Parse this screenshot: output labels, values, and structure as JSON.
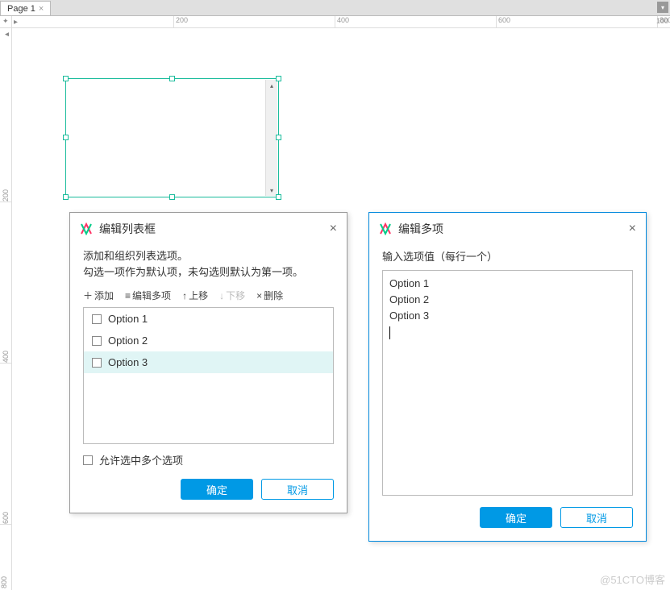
{
  "tabs": {
    "page1": "Page 1"
  },
  "ruler_h": [
    "200",
    "400",
    "600",
    "800",
    "100"
  ],
  "ruler_v": [
    "200",
    "400",
    "600",
    "800"
  ],
  "dialog1": {
    "title": "编辑列表框",
    "desc1": "添加和组织列表选项。",
    "desc2": "勾选一项作为默认项，未勾选则默认为第一项。",
    "toolbar": {
      "add": "添加",
      "edit_multi": "编辑多项",
      "move_up": "上移",
      "move_down": "下移",
      "delete": "删除"
    },
    "options": [
      "Option 1",
      "Option 2",
      "Option 3"
    ],
    "allow_multi": "允许选中多个选项",
    "ok": "确定",
    "cancel": "取消"
  },
  "dialog2": {
    "title": "编辑多项",
    "label": "输入选项值（每行一个）",
    "text": "Option 1\nOption 2\nOption 3",
    "ok": "确定",
    "cancel": "取消"
  },
  "watermark": "@51CTO博客"
}
